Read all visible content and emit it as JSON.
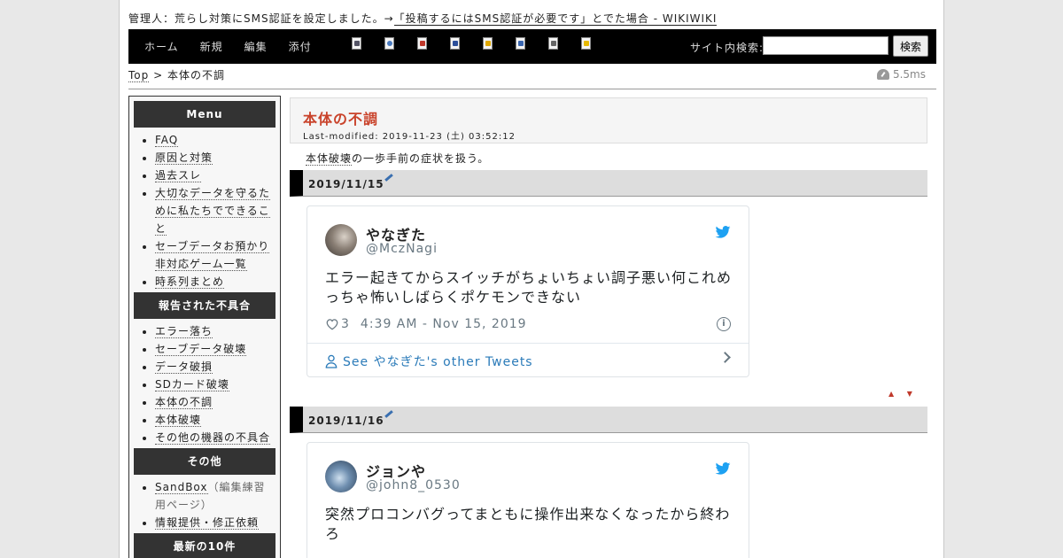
{
  "notice": {
    "prefix": "管理人：荒らし対策にSMS認証を設定しました。→",
    "link": "「投稿するにはSMS認証が必要です」とでた場合 - WIKIWIKI"
  },
  "nav": {
    "links": [
      "ホーム",
      "新規",
      "編集",
      "添付"
    ],
    "tool_icons": [
      "copy-page-icon",
      "rename-page-icon",
      "diff-icon",
      "backup-icon",
      "freeze-icon",
      "page-list-icon",
      "recent-changes-icon",
      "help-icon"
    ],
    "search_label": "サイト内検索:",
    "search_value": "",
    "search_button": "検索"
  },
  "breadcrumb": {
    "top": "Top",
    "sep": ">",
    "current": "本体の不調"
  },
  "timing": "5.5ms",
  "sidebar": {
    "sections": [
      {
        "title": "Menu",
        "items": [
          {
            "label": "FAQ"
          },
          {
            "label": "原因と対策"
          },
          {
            "label": "過去スレ"
          },
          {
            "label": "大切なデータを守るために私たちでできること"
          },
          {
            "label": "セーブデータお預かり非対応ゲーム一覧"
          },
          {
            "label": "時系列まとめ"
          }
        ]
      },
      {
        "title": "報告された不具合",
        "items": [
          {
            "label": "エラー落ち"
          },
          {
            "label": "セーブデータ破壊"
          },
          {
            "label": "データ破損"
          },
          {
            "label": "SDカード破壊"
          },
          {
            "label": "本体の不調"
          },
          {
            "label": "本体破壊"
          },
          {
            "label": "その他の機器の不具合"
          }
        ]
      },
      {
        "title": "その他",
        "items": [
          {
            "label": "SandBox",
            "note": "（編集練習用ページ）"
          },
          {
            "label": "情報提供・修正依頼"
          }
        ]
      },
      {
        "title": "最新の10件",
        "items": []
      }
    ]
  },
  "main": {
    "title": "本体の不調",
    "modified": "Last-modified: 2019-11-23 (土) 03:52:12",
    "intro_link": "本体破壊",
    "intro_text": "の一歩手前の症状を扱う。",
    "sections": [
      {
        "date": "2019/11/15",
        "tweet": {
          "name": "やなぎた",
          "handle": "@MczNagi",
          "text": "エラー起きてからスイッチがちょいちょい調子悪い何これめっちゃ怖いしばらくポケモンできない",
          "likes": "3",
          "time": "4:39 AM - Nov 15, 2019",
          "more": "See やなぎた's other Tweets",
          "avatar_color": "#6b6058"
        }
      },
      {
        "date": "2019/11/16",
        "tweet": {
          "name": "ジョンや",
          "handle": "@john8_0530",
          "text": "突然プロコンバグってまともに操作出来なくなったから終わろ",
          "avatar_color": "#3d5a78"
        }
      }
    ],
    "nav_arrows": "▲ ▼"
  },
  "colors": {
    "title_red": "#c9432b",
    "twitter_blue": "#1da1f2",
    "link_blue": "#2b7bb9"
  }
}
